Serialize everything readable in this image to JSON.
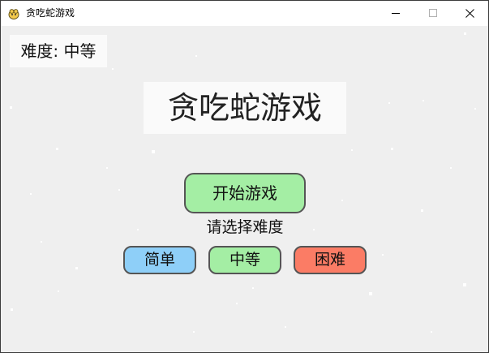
{
  "window": {
    "title": "贪吃蛇游戏",
    "icon": "pygame-snake-icon"
  },
  "titlebar_controls": {
    "minimize_icon": "minimize-icon",
    "maximize_icon": "maximize-icon",
    "close_icon": "close-icon"
  },
  "menu": {
    "difficulty_status": "难度: 中等",
    "title": "贪吃蛇游戏",
    "start_button": "开始游戏",
    "select_prompt": "请选择难度",
    "difficulty_options": [
      {
        "label": "简单",
        "color": "#8ecff8"
      },
      {
        "label": "中等",
        "color": "#a4eea4"
      },
      {
        "label": "困难",
        "color": "#fb7c65"
      }
    ]
  },
  "colors": {
    "background": "#efefef",
    "start_button": "#a4eea4",
    "button_border": "#555555",
    "snow": "#ffffff"
  }
}
